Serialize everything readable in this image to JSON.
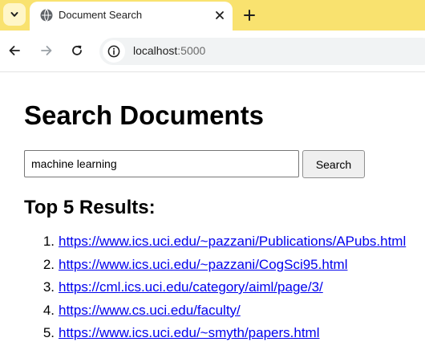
{
  "browser": {
    "tab": {
      "title": "Document Search"
    },
    "address_bar": {
      "host": "localhost",
      "port": ":5000"
    }
  },
  "page": {
    "title": "Search Documents",
    "search": {
      "value": "machine learning",
      "button_label": "Search"
    },
    "results_heading": "Top 5 Results:",
    "results": [
      {
        "number": "1.",
        "url": "https://www.ics.uci.edu/~pazzani/Publications/APubs.html"
      },
      {
        "number": "2.",
        "url": "https://www.ics.uci.edu/~pazzani/CogSci95.html"
      },
      {
        "number": "3.",
        "url": "https://cml.ics.uci.edu/category/aiml/page/3/"
      },
      {
        "number": "4.",
        "url": "https://www.cs.uci.edu/faculty/"
      },
      {
        "number": "5.",
        "url": "https://www.ics.uci.edu/~smyth/papers.html"
      }
    ]
  },
  "colors": {
    "tab_strip": "#f9e26f",
    "link": "#0000ee"
  },
  "icons": [
    "chevron-down-icon",
    "globe-icon",
    "close-icon",
    "plus-icon",
    "back-arrow-icon",
    "forward-arrow-icon",
    "reload-icon",
    "info-icon"
  ]
}
